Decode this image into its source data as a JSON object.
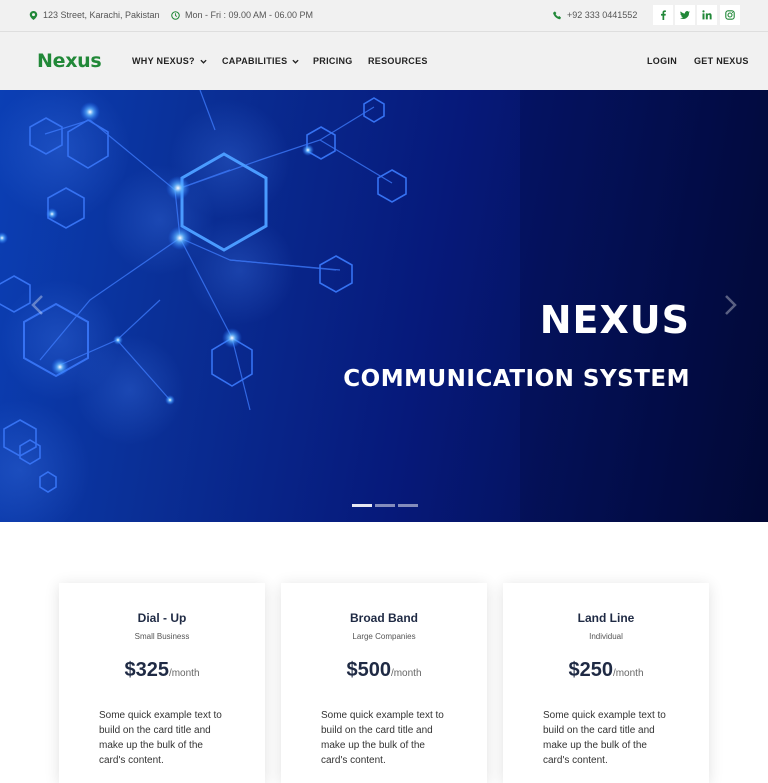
{
  "topbar": {
    "address": "123 Street, Karachi, Pakistan",
    "hours": "Mon - Fri : 09.00 AM - 06.00 PM",
    "phone": "+92 333 0441552",
    "social": [
      "facebook-icon",
      "twitter-icon",
      "linkedin-icon",
      "instagram-icon"
    ]
  },
  "nav": {
    "brand": "Nexus",
    "links": [
      "WHY NEXUS?",
      "CAPABILITIES",
      "PRICING",
      "RESOURCES"
    ],
    "right_links": [
      "LOGIN",
      "GET NEXUS"
    ]
  },
  "hero": {
    "title": "NEXUS",
    "subtitle": "COMMUNICATION SYSTEM"
  },
  "pricing": [
    {
      "title": "Dial - Up",
      "subtitle": "Small Business",
      "price": "$325",
      "period": "/month",
      "text": "Some quick example text to build on the card title and make up the bulk of the card's content."
    },
    {
      "title": "Broad Band",
      "subtitle": "Large Companies",
      "price": "$500",
      "period": "/month",
      "text": "Some quick example text to build on the card title and make up the bulk of the card's content."
    },
    {
      "title": "Land Line",
      "subtitle": "Individual",
      "price": "$250",
      "period": "/month",
      "text": "Some quick example text to build on the card title and make up the bulk of the card's content."
    }
  ],
  "colors": {
    "brand": "#218838",
    "heading": "#1f2a44",
    "hero_dark": "#020a3a",
    "hero_light": "#0b3fb5"
  }
}
